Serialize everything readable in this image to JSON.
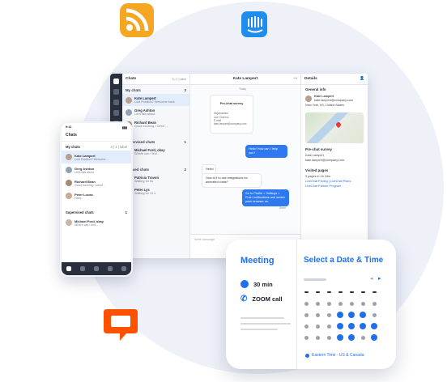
{
  "desktop": {
    "list_title": "Chats",
    "list_count": "5 | 1 | label",
    "section_my": "My chats",
    "section_my_count": "3",
    "chats": [
      {
        "name": "Kate Lampert",
        "preview": "Lost Position? Welcome back"
      },
      {
        "name": "Greg Ashton",
        "preview": "Let's talk about"
      },
      {
        "name": "Richard Bean",
        "preview": "Good morning, I need ..."
      }
    ],
    "section_supervised": "Supervised chats",
    "supervised_count": "1",
    "supervised": [
      {
        "name": "Michael Ford, okay",
        "preview": "Where can I find..."
      }
    ],
    "section_queued": "Queued chats",
    "queued_count": "2",
    "queued": [
      {
        "name": "Patricia Travon",
        "preview": "Waiting for 5s"
      },
      {
        "name": "Peter Lys",
        "preview": "Waiting for 12 s"
      }
    ],
    "chat_title": "Kate Lampert",
    "chat_day": "Today",
    "survey_title": "Pre-chat survey",
    "survey_body": "Organization\nLive Chat Inc.\nE-mail\nkate.lampert@company.com",
    "msg_in_1": "Hello!",
    "msg_in_2": "How is it to use integrations for animated chats?",
    "msg_out_1": "Hello! How can I help you?",
    "msg_out_2": "Go to Profile > Settings > Push notifications and switch push browser on.",
    "msg_seen": "Seen",
    "composer_placeholder": "Write message",
    "details_title": "Details",
    "general_info": "General info",
    "contact_name": "Kate Lampert",
    "contact_email": "kate.lampert@company.com",
    "contact_location": "New York, NY, United States",
    "prechat_title": "Pre-chat survey",
    "prechat_name": "Kate Lampert",
    "prechat_email": "kate.lampert@company.com",
    "visited_title": "Visited pages",
    "visited_count": "3 pages in 1h 24m",
    "visited_1": "LiveChat Pricing | LiveChat Plans",
    "visited_2": "LiveChat Partner Program"
  },
  "phone": {
    "time": "9:41",
    "title": "Chats",
    "section_my": "My chats",
    "section_my_count": "3 | 1 | label",
    "chats": [
      {
        "name": "Kate Lampert",
        "preview": "Lost Position? Welcome..."
      },
      {
        "name": "Greg Ashton",
        "preview": "Let's talk about"
      },
      {
        "name": "Richard Bean",
        "preview": "Good morning, I need..."
      },
      {
        "name": "Peter Lucas",
        "preview": "Hello"
      }
    ],
    "section_supervised": "Supervised chats",
    "supervised_count": "1",
    "supervised": [
      {
        "name": "Michael Ford, okay",
        "preview": "Where can I find..."
      }
    ]
  },
  "schedule": {
    "meeting_title": "Meeting",
    "duration": "30 min",
    "call_type": "ZOOM call",
    "select_title": "Select a Date & Time",
    "timezone": "Eastern Time - US & Canada",
    "weekday_headers": 7,
    "available_days": [
      10,
      11,
      12,
      17,
      18,
      19,
      20,
      24,
      25,
      27
    ]
  },
  "colors": {
    "accent": "#1f6feb",
    "rss": "#f5a623",
    "intercom": "#1f8ded",
    "livechat": "#ff5100"
  }
}
